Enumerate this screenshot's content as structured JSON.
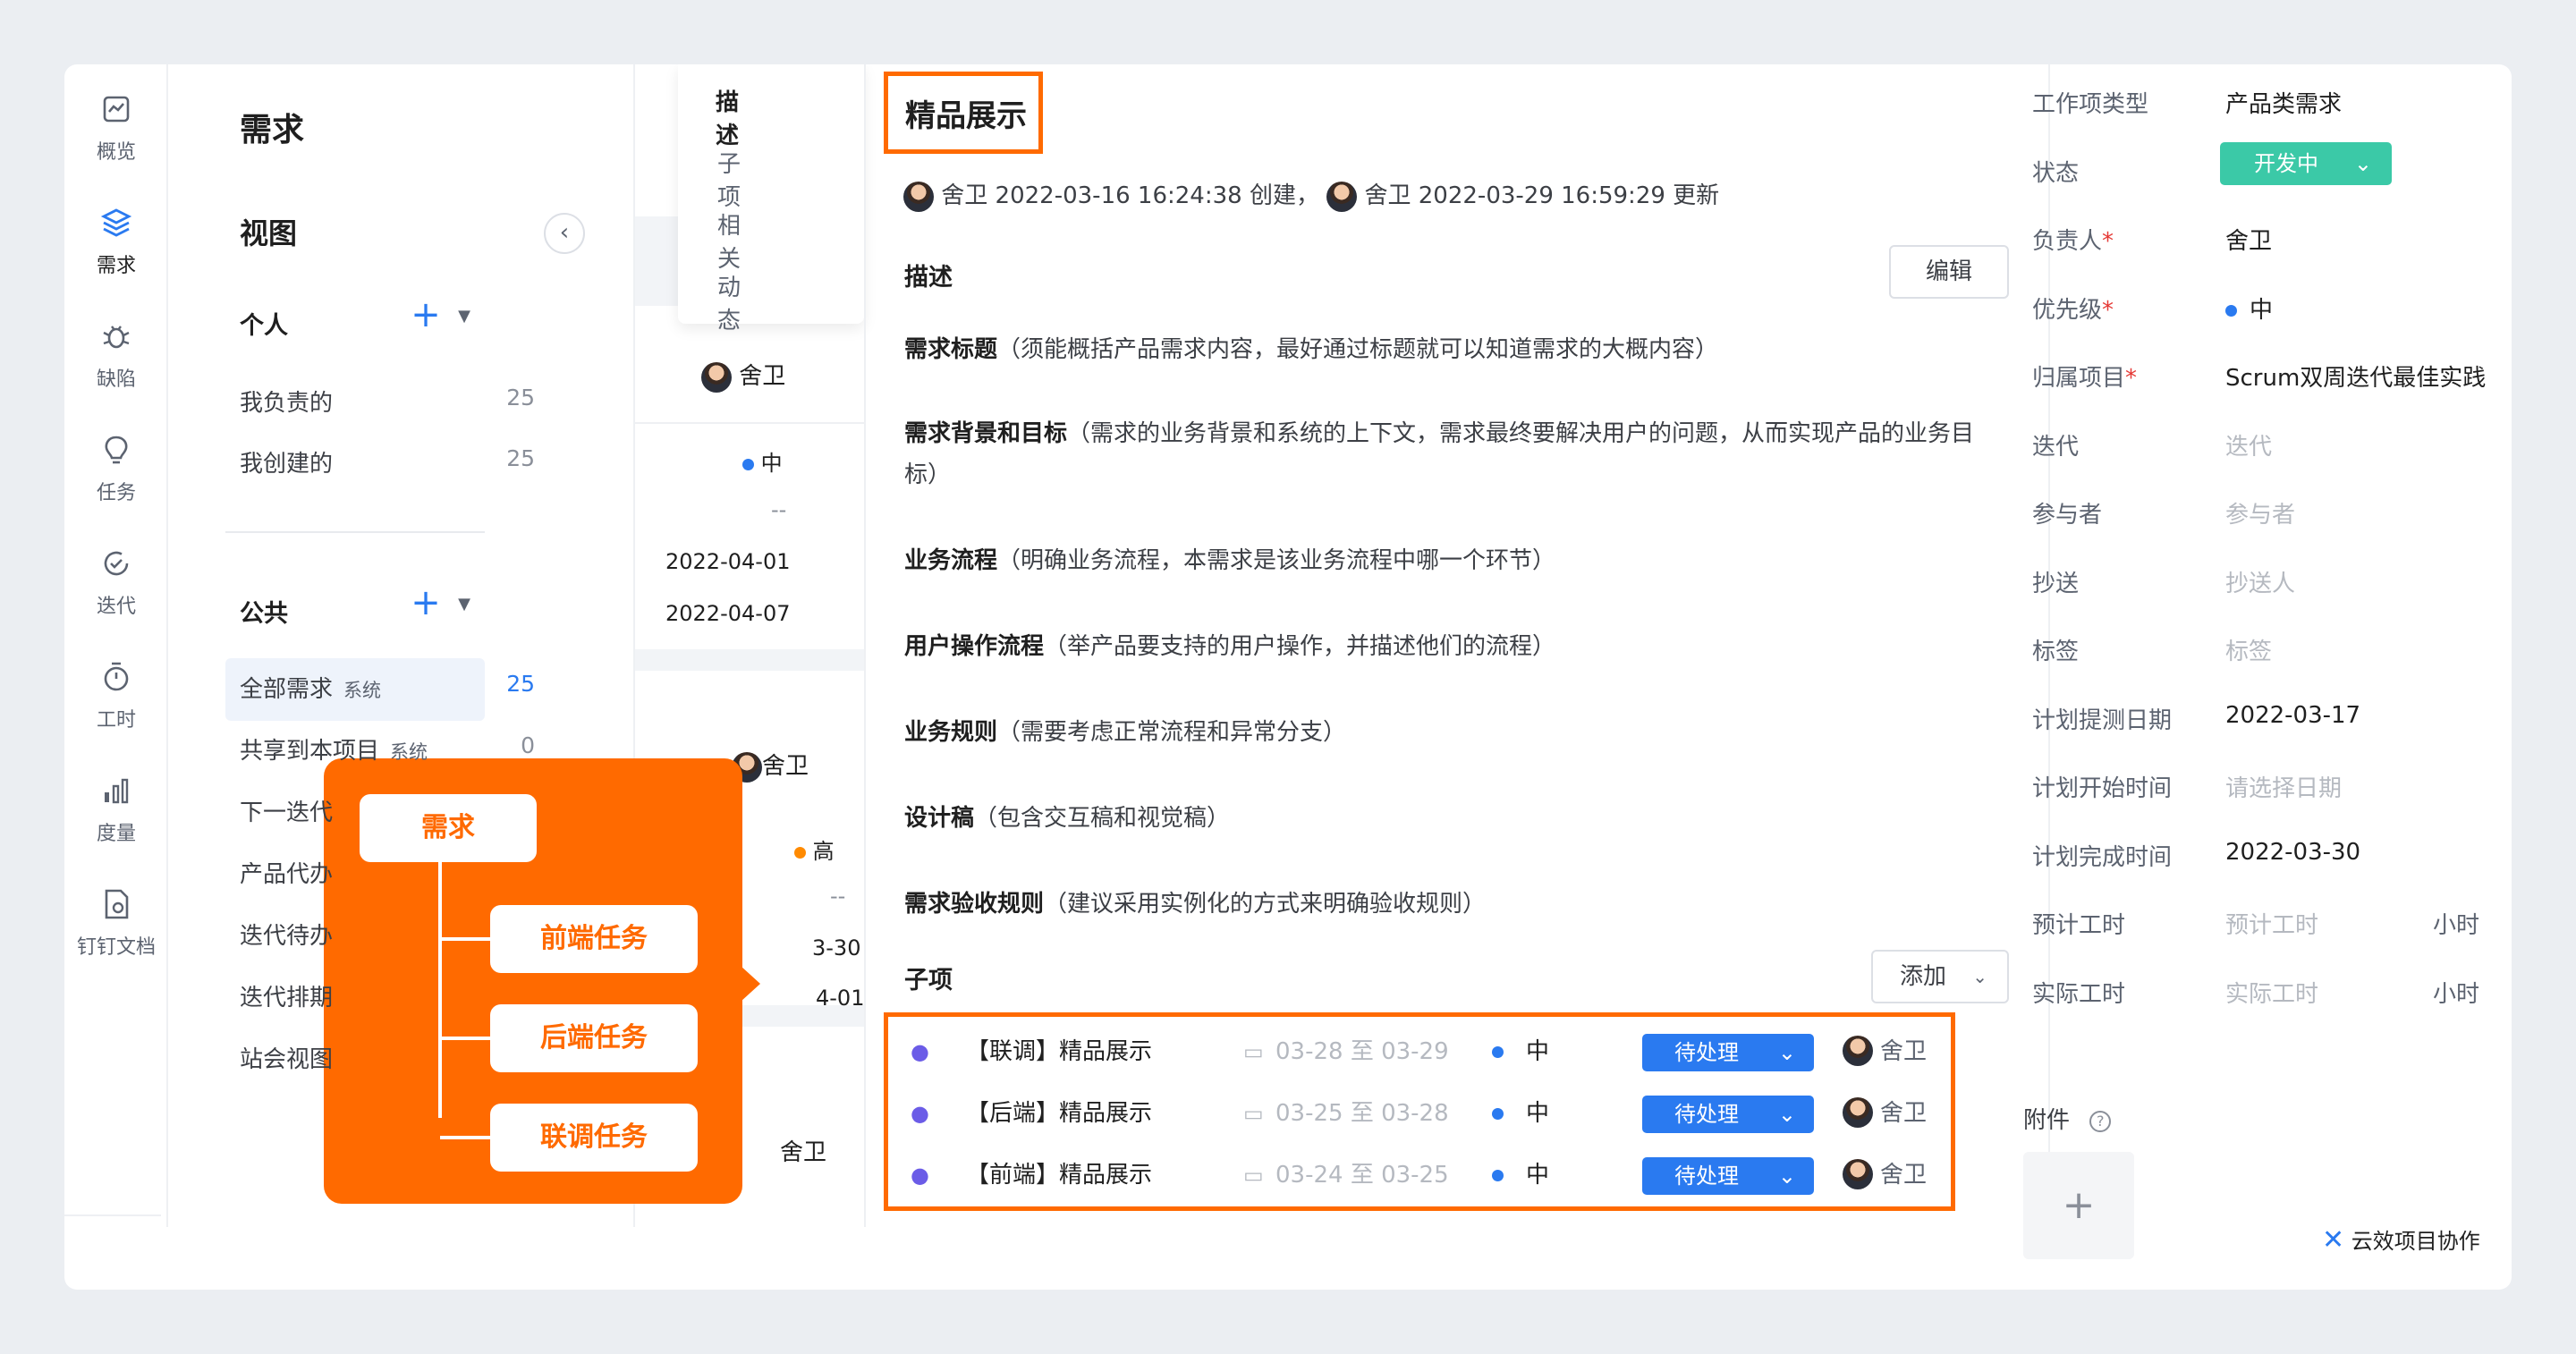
{
  "nav": [
    {
      "label": "概览",
      "icon": "overview-icon"
    },
    {
      "label": "需求",
      "icon": "layers-icon",
      "active": true
    },
    {
      "label": "缺陷",
      "icon": "bug-icon"
    },
    {
      "label": "任务",
      "icon": "bulb-icon"
    },
    {
      "label": "迭代",
      "icon": "cycle-icon"
    },
    {
      "label": "工时",
      "icon": "timer-icon"
    },
    {
      "label": "度量",
      "icon": "bar-chart-icon"
    },
    {
      "label": "钉钉文档",
      "icon": "doc-icon"
    }
  ],
  "sidebar": {
    "title": "需求",
    "view_title": "视图",
    "personal_label": "个人",
    "personal_items": [
      {
        "label": "我负责的",
        "count": "25"
      },
      {
        "label": "我创建的",
        "count": "25"
      }
    ],
    "public_label": "公共",
    "public_items": [
      {
        "label": "全部需求",
        "tag": "系统",
        "count": "25",
        "active": true
      },
      {
        "label": "共享到本项目",
        "tag": "系统",
        "count": "0"
      },
      {
        "label": "下一迭代"
      },
      {
        "label": "产品代办"
      },
      {
        "label": "迭代待办"
      },
      {
        "label": "迭代排期"
      },
      {
        "label": "站会视图"
      }
    ]
  },
  "list_peek": {
    "assignee": "舍卫",
    "priority": "中",
    "dash": "--",
    "date1": "2022-04-01",
    "date2": "2022-04-07",
    "assignee2": "舍卫",
    "priority2": "高",
    "dash2": "--",
    "date3": "3-30",
    "date4": "4-01",
    "assignee3": "舍卫"
  },
  "detail_tabs": [
    "描述",
    "子项",
    "相关",
    "动态"
  ],
  "detail": {
    "title": "精品展示",
    "creator": "舍卫",
    "created_at": "2022-03-16 16:24:38 创建，",
    "updater": "舍卫",
    "updated_at": "2022-03-29 16:59:29 更新",
    "desc_label": "描述",
    "edit_label": "编辑",
    "sections": [
      {
        "title": "需求标题",
        "body": "（须能概括产品需求内容，最好通过标题就可以知道需求的大概内容）"
      },
      {
        "title": "需求背景和目标",
        "body": "（需求的业务背景和系统的上下文，需求最终要解决用户的问题，从而实现产品的业务目标）"
      },
      {
        "title": "业务流程",
        "body": "（明确业务流程，本需求是该业务流程中哪一个环节）"
      },
      {
        "title": "用户操作流程",
        "body": "（举产品要支持的用户操作，并描述他们的流程）"
      },
      {
        "title": "业务规则",
        "body": "（需要考虑正常流程和异常分支）"
      },
      {
        "title": "设计稿",
        "body": "（包含交互稿和视觉稿）"
      },
      {
        "title": "需求验收规则",
        "body": "（建议采用实例化的方式来明确验收规则）"
      }
    ],
    "sub_label": "子项",
    "add_label": "添加",
    "subitems": [
      {
        "name": "【联调】精品展示",
        "dates": "03-28 至 03-29",
        "priority": "中",
        "status": "待处理",
        "assignee": "舍卫"
      },
      {
        "name": "【后端】精品展示",
        "dates": "03-25 至 03-28",
        "priority": "中",
        "status": "待处理",
        "assignee": "舍卫"
      },
      {
        "name": "【前端】精品展示",
        "dates": "03-24 至 03-25",
        "priority": "中",
        "status": "待处理",
        "assignee": "舍卫"
      }
    ]
  },
  "props": [
    {
      "label": "工作项类型",
      "value": "产品类需求"
    },
    {
      "label": "状态",
      "value": "开发中",
      "type": "status"
    },
    {
      "label": "负责人",
      "required": true,
      "value": "舍卫"
    },
    {
      "label": "优先级",
      "required": true,
      "value": "中",
      "type": "priority"
    },
    {
      "label": "归属项目",
      "required": true,
      "value": "Scrum双周迭代最佳实践"
    },
    {
      "label": "迭代",
      "value": "迭代",
      "placeholder": true
    },
    {
      "label": "参与者",
      "value": "参与者",
      "placeholder": true
    },
    {
      "label": "抄送",
      "value": "抄送人",
      "placeholder": true
    },
    {
      "label": "标签",
      "value": "标签",
      "placeholder": true
    },
    {
      "label": "计划提测日期",
      "value": "2022-03-17"
    },
    {
      "label": "计划开始时间",
      "value": "请选择日期",
      "placeholder": true
    },
    {
      "label": "计划完成时间",
      "value": "2022-03-30"
    },
    {
      "label": "预计工时",
      "value": "预计工时",
      "placeholder": true,
      "unit": "小时"
    },
    {
      "label": "实际工时",
      "value": "实际工时",
      "placeholder": true,
      "unit": "小时"
    }
  ],
  "attach_label": "附件",
  "brand": "云效项目协作",
  "overlay": {
    "root": "需求",
    "children": [
      "前端任务",
      "后端任务",
      "联调任务"
    ]
  },
  "colors": {
    "accent": "#2a7af0",
    "highlight": "#ff6a00",
    "status_green": "#3bc9a7"
  }
}
